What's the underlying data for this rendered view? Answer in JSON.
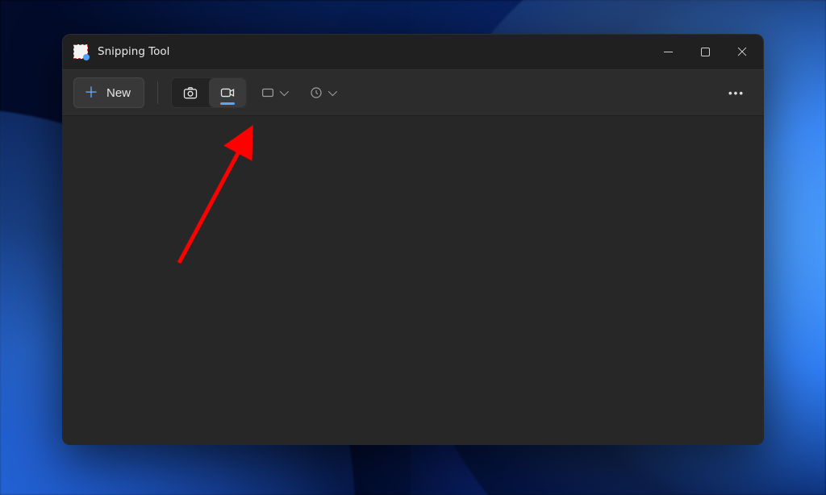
{
  "window": {
    "title": "Snipping Tool"
  },
  "toolbar": {
    "new_label": "New"
  }
}
